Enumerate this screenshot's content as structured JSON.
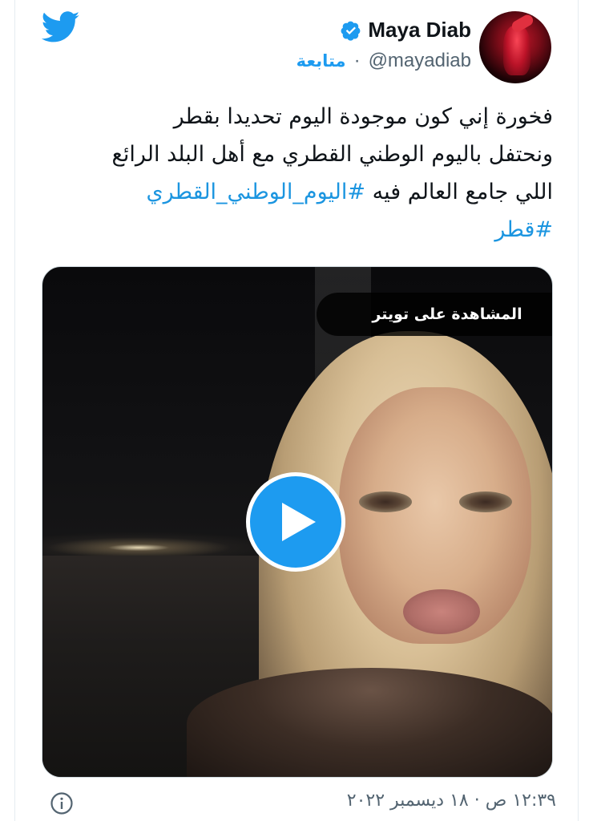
{
  "tweet": {
    "author": {
      "name": "Maya Diab",
      "handle": "@mayadiab",
      "separator": "·",
      "follow_label": "متابعة"
    },
    "text_lines": [
      "فخورة إني كون موجودة اليوم تحديدا بقطر",
      "ونحتفل باليوم الوطني القطري مع أهل البلد الرائع",
      "اللي جامع العالم فيه"
    ],
    "hashtags": [
      "#اليوم_الوطني_القطري",
      "#قطر"
    ],
    "media": {
      "watch_label": "المشاهدة على تويتر"
    },
    "timestamp": "١٢:٣٩ ص · ١٨ ديسمبر ٢٠٢٢"
  },
  "colors": {
    "accent": "#1d9bf0",
    "text": "#0f1419",
    "muted": "#536471"
  },
  "icons": [
    "twitter-bird-icon",
    "verified-badge-icon",
    "play-icon",
    "info-icon"
  ]
}
